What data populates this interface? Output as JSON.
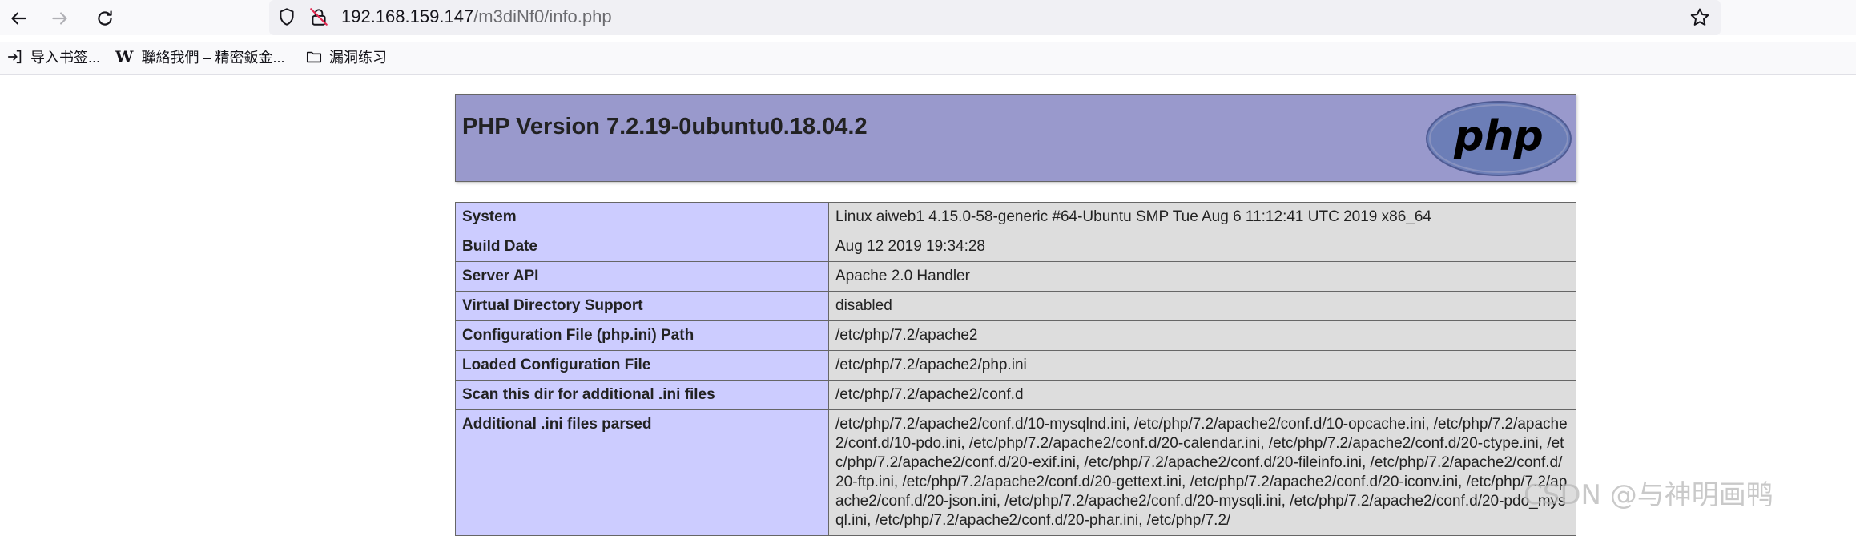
{
  "browser": {
    "url_host": "192.168.159.147",
    "url_path": "/m3diNf0/info.php"
  },
  "bookmarks": [
    {
      "label": "导入书签...",
      "icon": "import-icon"
    },
    {
      "label": "聯絡我們 – 精密鈑金...",
      "icon": "w-logo-icon"
    },
    {
      "label": "漏洞练习",
      "icon": "folder-icon"
    }
  ],
  "php": {
    "title": "PHP Version 7.2.19-0ubuntu0.18.04.2",
    "logo_text": "php",
    "rows": [
      {
        "key": "System",
        "value": "Linux aiweb1 4.15.0-58-generic #64-Ubuntu SMP Tue Aug 6 11:12:41 UTC 2019 x86_64"
      },
      {
        "key": "Build Date",
        "value": "Aug 12 2019 19:34:28"
      },
      {
        "key": "Server API",
        "value": "Apache 2.0 Handler"
      },
      {
        "key": "Virtual Directory Support",
        "value": "disabled"
      },
      {
        "key": "Configuration File (php.ini) Path",
        "value": "/etc/php/7.2/apache2"
      },
      {
        "key": "Loaded Configuration File",
        "value": "/etc/php/7.2/apache2/php.ini"
      },
      {
        "key": "Scan this dir for additional .ini files",
        "value": "/etc/php/7.2/apache2/conf.d"
      },
      {
        "key": "Additional .ini files parsed",
        "value": "/etc/php/7.2/apache2/conf.d/10-mysqlnd.ini, /etc/php/7.2/apache2/conf.d/10-opcache.ini, /etc/php/7.2/apache2/conf.d/10-pdo.ini, /etc/php/7.2/apache2/conf.d/20-calendar.ini, /etc/php/7.2/apache2/conf.d/20-ctype.ini, /etc/php/7.2/apache2/conf.d/20-exif.ini, /etc/php/7.2/apache2/conf.d/20-fileinfo.ini, /etc/php/7.2/apache2/conf.d/20-ftp.ini, /etc/php/7.2/apache2/conf.d/20-gettext.ini, /etc/php/7.2/apache2/conf.d/20-iconv.ini, /etc/php/7.2/apache2/conf.d/20-json.ini, /etc/php/7.2/apache2/conf.d/20-mysqli.ini, /etc/php/7.2/apache2/conf.d/20-pdo_mysql.ini, /etc/php/7.2/apache2/conf.d/20-phar.ini, /etc/php/7.2/"
      }
    ],
    "header_color": "#9999cc",
    "key_color": "#ccccff",
    "value_color": "#dddddd"
  },
  "watermark": "CSDN @与神明画鸭"
}
